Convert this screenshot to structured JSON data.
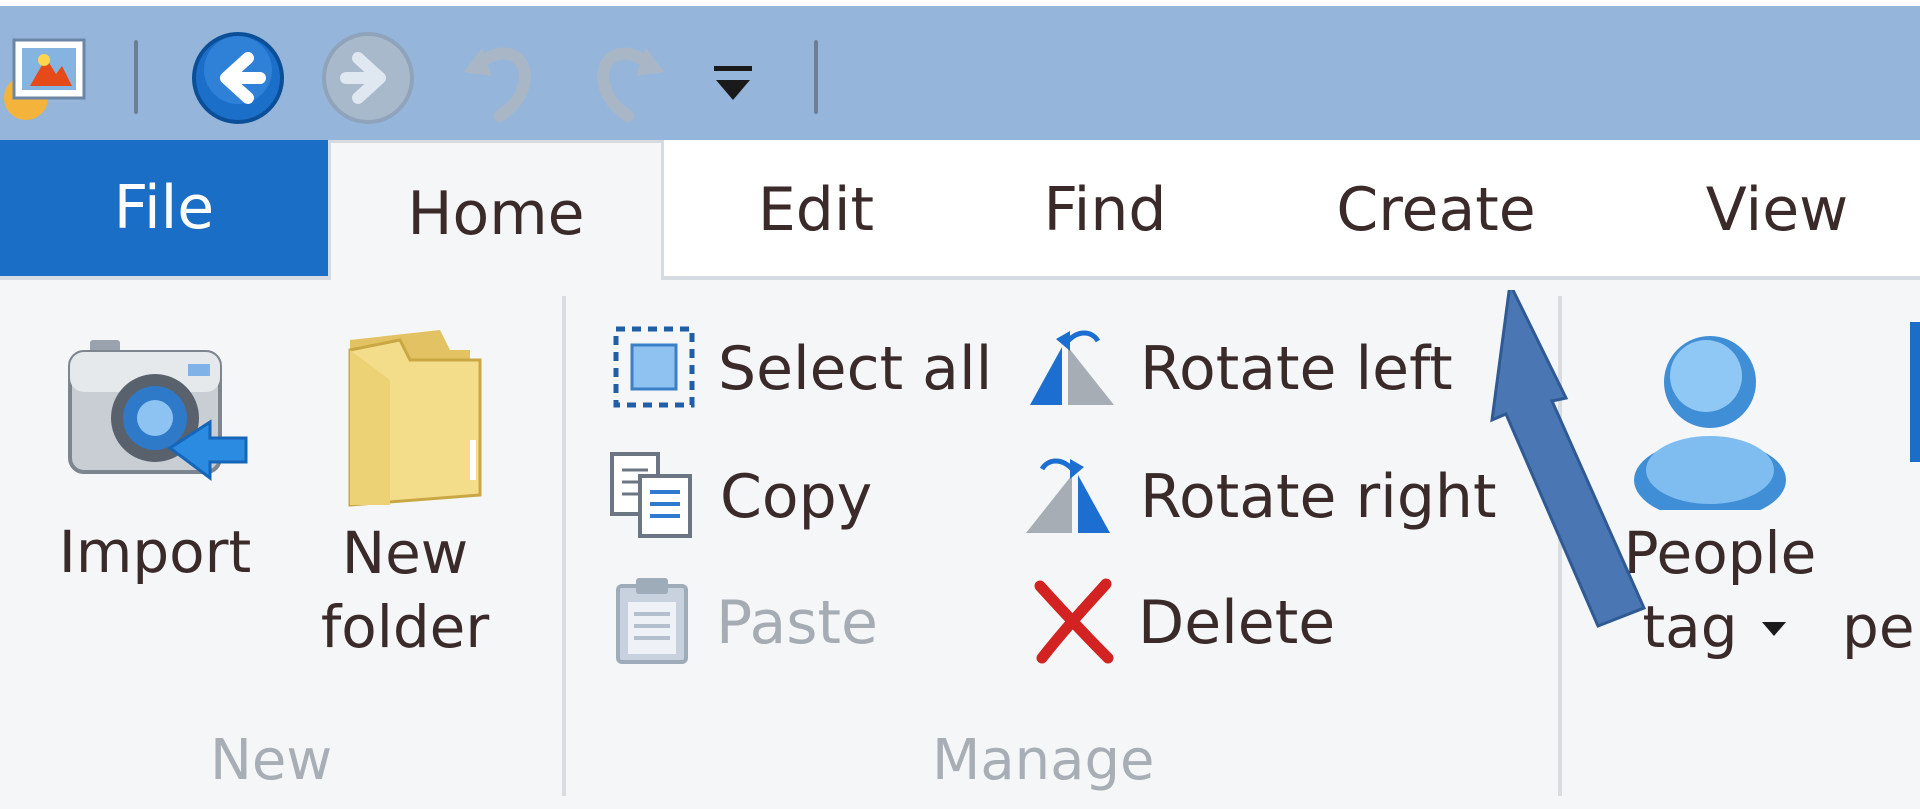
{
  "qat": {
    "app_icon": "photo-gallery-icon",
    "back_icon": "back-arrow-icon",
    "forward_icon": "forward-arrow-icon",
    "undo_icon": "undo-icon",
    "redo_icon": "redo-icon",
    "customize_icon": "customize-dropdown-icon"
  },
  "tabs": [
    {
      "label": "File"
    },
    {
      "label": "Home"
    },
    {
      "label": "Edit"
    },
    {
      "label": "Find"
    },
    {
      "label": "Create"
    },
    {
      "label": "View"
    }
  ],
  "groups": {
    "new": {
      "name": "New",
      "import_label": "Import",
      "new_folder_line1": "New",
      "new_folder_line2": "folder"
    },
    "manage": {
      "name": "Manage",
      "select_all": "Select all",
      "copy": "Copy",
      "paste": "Paste",
      "rotate_left": "Rotate left",
      "rotate_right": "Rotate right",
      "delete": "Delete"
    },
    "organize": {
      "people_tag_line1": "People",
      "people_tag_line2": "tag",
      "partial_label": "pe"
    }
  },
  "colors": {
    "file_tab": "#1a6ec6",
    "title_bar": "#95b6da",
    "annotation_arrow": "#4a76b3"
  }
}
